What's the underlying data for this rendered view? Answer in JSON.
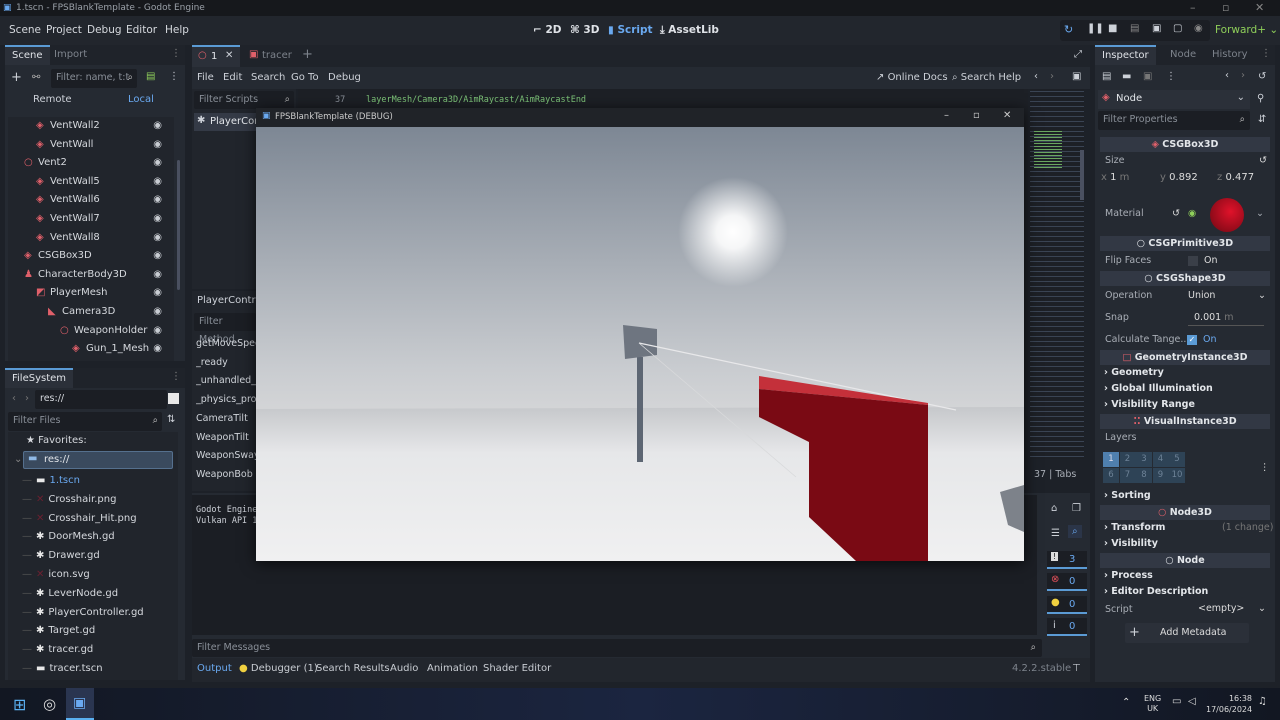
{
  "window": {
    "title": "1.tscn - FPSBlankTemplate - Godot Engine"
  },
  "menu": [
    "Scene",
    "Project",
    "Debug",
    "Editor",
    "Help"
  ],
  "workspaces": [
    "2D",
    "3D",
    "Script",
    "AssetLib"
  ],
  "renderer": "Forward+",
  "scene_dock": {
    "tabs": [
      "Scene",
      "Import"
    ],
    "filter_placeholder": "Filter: name, t:t",
    "remote": "Remote",
    "local": "Local",
    "items": [
      {
        "name": "VentWall2",
        "depth": 1,
        "icon": "csg-box-icon"
      },
      {
        "name": "VentWall",
        "depth": 1,
        "icon": "csg-box-icon"
      },
      {
        "name": "Vent2",
        "depth": 0,
        "icon": "node3d-icon"
      },
      {
        "name": "VentWall5",
        "depth": 1,
        "icon": "csg-box-icon"
      },
      {
        "name": "VentWall6",
        "depth": 1,
        "icon": "csg-box-icon"
      },
      {
        "name": "VentWall7",
        "depth": 1,
        "icon": "csg-box-icon"
      },
      {
        "name": "VentWall8",
        "depth": 1,
        "icon": "csg-box-icon"
      },
      {
        "name": "CSGBox3D",
        "depth": 0,
        "icon": "csg-box-icon"
      },
      {
        "name": "CharacterBody3D",
        "depth": 0,
        "icon": "character-body-icon"
      },
      {
        "name": "PlayerMesh",
        "depth": 1,
        "icon": "mesh-icon"
      },
      {
        "name": "Camera3D",
        "depth": 2,
        "icon": "camera-icon"
      },
      {
        "name": "WeaponHolder",
        "depth": 3,
        "icon": "node3d-icon"
      },
      {
        "name": "Gun_1_Mesh",
        "depth": 4,
        "icon": "csg-box-icon"
      }
    ]
  },
  "filesystem": {
    "tab": "FileSystem",
    "path": "res://",
    "filter_placeholder": "Filter Files",
    "favorites": "Favorites:",
    "root": "res://",
    "files": [
      {
        "name": "1.tscn",
        "icon": "scene-icon"
      },
      {
        "name": "Crosshair.png",
        "icon": "image-icon"
      },
      {
        "name": "Crosshair_Hit.png",
        "icon": "image-icon"
      },
      {
        "name": "DoorMesh.gd",
        "icon": "gear-icon"
      },
      {
        "name": "Drawer.gd",
        "icon": "gear-icon"
      },
      {
        "name": "icon.svg",
        "icon": "image-icon"
      },
      {
        "name": "LeverNode.gd",
        "icon": "gear-icon"
      },
      {
        "name": "PlayerController.gd",
        "icon": "gear-icon"
      },
      {
        "name": "Target.gd",
        "icon": "gear-icon"
      },
      {
        "name": "tracer.gd",
        "icon": "gear-icon"
      },
      {
        "name": "tracer.tscn",
        "icon": "scene-icon"
      }
    ]
  },
  "script_editor": {
    "tabs": [
      "1",
      "tracer"
    ],
    "menu": [
      "File",
      "Edit",
      "Search",
      "Go To",
      "Debug"
    ],
    "online_docs": "Online Docs",
    "search_help": "Search Help",
    "filter_scripts": "Filter Scripts",
    "script_item": "PlayerCon",
    "line_no": "37",
    "code_line": "layerMesh/Camera3D/AimRaycast/AimRaycastEnd",
    "script_label": "PlayerContro",
    "filter_methods": "Filter Method",
    "methods": [
      "getMoveSpee",
      "_ready",
      "_unhandled_i",
      "_physics_proc",
      "CameraTilt",
      "WeaponTilt",
      "WeaponSway",
      "WeaponBob"
    ],
    "status": "37  |  Tabs"
  },
  "output": {
    "lines": [
      "Godot Engine",
      "Vulkan API 1"
    ],
    "filter_placeholder": "Filter Messages",
    "counts": {
      "all": "3",
      "errors": "0",
      "warnings": "0",
      "info": "0"
    }
  },
  "bottom_tabs": [
    "Output",
    "Debugger (1)",
    "Search Results",
    "Audio",
    "Animation",
    "Shader Editor"
  ],
  "version": "4.2.2.stable",
  "game_window": {
    "title": "FPSBlankTemplate (DEBUG)"
  },
  "inspector": {
    "tabs": [
      "Inspector",
      "Node",
      "History"
    ],
    "node": "Node",
    "filter_placeholder": "Filter Properties",
    "csgbox": "CSGBox3D",
    "size_label": "Size",
    "size": {
      "x": "1",
      "y": "0.892",
      "z": "0.477",
      "unit": "m"
    },
    "material_label": "Material",
    "material_color": "#e0122a",
    "csgprimitive": "CSGPrimitive3D",
    "flip_faces": "Flip Faces",
    "flip_value": "On",
    "csgshape": "CSGShape3D",
    "operation": "Operation",
    "operation_value": "Union",
    "snap": "Snap",
    "snap_value": "0.001",
    "snap_unit": "m",
    "calc_tangents": "Calculate Tange...",
    "calc_value": "On",
    "geometry_instance": "GeometryInstance3D",
    "groups1": [
      "Geometry",
      "Global Illumination",
      "Visibility Range"
    ],
    "visual_instance": "VisualInstance3D",
    "layers": "Layers",
    "layer_nums": [
      "1",
      "2",
      "3",
      "4",
      "5",
      "6",
      "7",
      "8",
      "9",
      "10"
    ],
    "sorting": "Sorting",
    "node3d": "Node3D",
    "transform": "Transform",
    "transform_changes": "(1 change)",
    "visibility": "Visibility",
    "process": "Process",
    "editor_description": "Editor Description",
    "script": "Script",
    "script_value": "<empty>",
    "add_metadata": "Add Metadata"
  },
  "taskbar": {
    "lang1": "ENG",
    "lang2": "UK",
    "time": "16:38",
    "date": "17/06/2024"
  },
  "colors": {
    "accent": "#5b9bd5",
    "script_ws": "#6aa9f0",
    "renderer": "#8fcf5a"
  }
}
